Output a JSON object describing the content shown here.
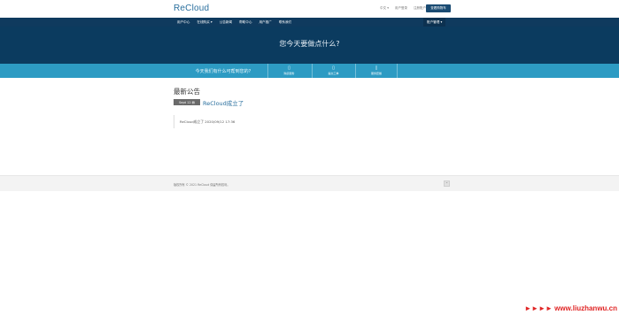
{
  "header": {
    "logo": "ReCloud",
    "links": [
      "中文 ▾",
      "用户登录",
      "注册账户"
    ],
    "cart_button": "查看购物车"
  },
  "nav": {
    "items": [
      "用户中心",
      "在线购买 ▾",
      "公告新闻",
      "帮助中心",
      "用户推广",
      "联系我们"
    ],
    "account": "账户管理 ▾"
  },
  "hero": {
    "title": "您今天要做点什么?"
  },
  "actionbar": {
    "prompt": "今天我们有什么可帮到您的?",
    "actions": [
      {
        "icon": "▯",
        "label": "购买服务"
      },
      {
        "icon": "▯",
        "label": "提交工单"
      },
      {
        "icon": "▯",
        "label": "服务套餐"
      }
    ]
  },
  "announcements": {
    "section_title": "最新公告",
    "items": [
      {
        "date": "Sept 12",
        "date_icon": "▤",
        "title": "ReCloud成立了",
        "body": "ReCloud成立了 2020/09/12 17:36"
      }
    ]
  },
  "footer": {
    "text": "版权所有 © 2021 ReCloud 保留所有权利。",
    "back_to_top": "⌃"
  },
  "watermark": {
    "arrows": "►►►►",
    "site": "www.liuzhanwu.cn"
  }
}
